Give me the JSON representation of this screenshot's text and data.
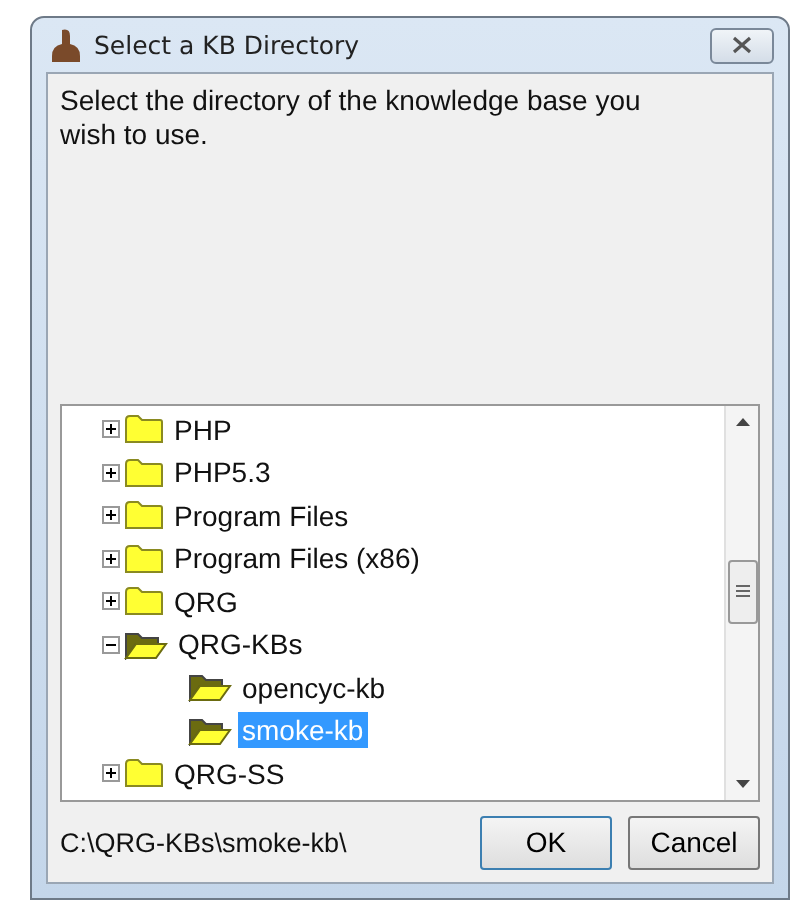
{
  "window": {
    "title": "Select a KB Directory"
  },
  "message": "Select the directory of the knowledge base you wish to use.",
  "tree": [
    {
      "label": "PHP",
      "expanded": false,
      "selected": false
    },
    {
      "label": "PHP5.3",
      "expanded": false,
      "selected": false
    },
    {
      "label": "Program Files",
      "expanded": false,
      "selected": false
    },
    {
      "label": "Program Files (x86)",
      "expanded": false,
      "selected": false
    },
    {
      "label": "QRG",
      "expanded": false,
      "selected": false
    },
    {
      "label": "QRG-KBs",
      "expanded": true,
      "selected": false,
      "children": [
        {
          "label": "opencyc-kb",
          "selected": false
        },
        {
          "label": "smoke-kb",
          "selected": true
        }
      ]
    },
    {
      "label": "QRG-SS",
      "expanded": false,
      "selected": false
    }
  ],
  "path": "C:\\QRG-KBs\\smoke-kb\\",
  "buttons": [
    "OK",
    "Cancel"
  ]
}
